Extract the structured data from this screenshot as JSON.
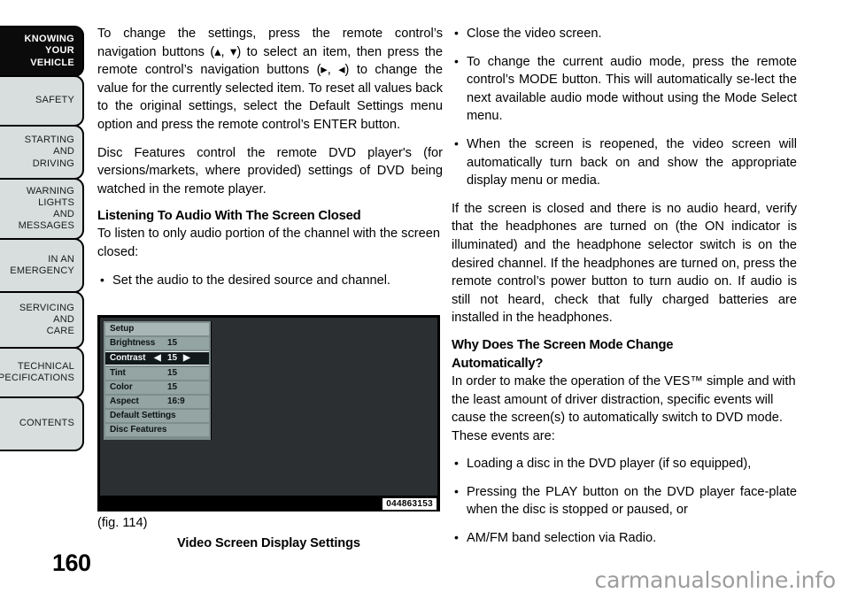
{
  "sidebar": {
    "items": [
      {
        "label": "KNOWING\nYOUR\nVEHICLE",
        "lines": [
          "KNOWING",
          "YOUR",
          "VEHICLE"
        ],
        "active": true
      },
      {
        "label": "SAFETY",
        "lines": [
          "SAFETY"
        ],
        "active": false
      },
      {
        "label": "STARTING AND DRIVING",
        "lines": [
          "STARTING",
          "AND",
          "DRIVING"
        ],
        "active": false
      },
      {
        "label": "WARNING LIGHTS AND MESSAGES",
        "lines": [
          "WARNING",
          "LIGHTS",
          "AND",
          "MESSAGES"
        ],
        "active": false
      },
      {
        "label": "IN AN EMERGENCY",
        "lines": [
          "IN AN",
          "EMERGENCY"
        ],
        "active": false
      },
      {
        "label": "SERVICING AND CARE",
        "lines": [
          "SERVICING",
          "AND",
          "CARE"
        ],
        "active": false
      },
      {
        "label": "TECHNICAL SPECIFICATIONS",
        "lines": [
          "TECHNICAL",
          "SPECIFICATIONS"
        ],
        "active": false
      },
      {
        "label": "CONTENTS",
        "lines": [
          "CONTENTS"
        ],
        "active": false
      }
    ]
  },
  "page": {
    "number": "160",
    "watermark": "carmanualsonline.info"
  },
  "left_column": {
    "para1": "To change the settings, press the remote control’s navigation buttons (▴, ▾) to select an item, then press the remote control’s navigation buttons (▸, ◂) to change the value for the currently selected item. To reset all values back to the original settings, select the Default Settings menu option and press the remote control’s ENTER button.",
    "para2": "Disc Features control the remote DVD player's (for versions/markets, where provided) settings of DVD being watched in the remote player.",
    "subheading": "Listening To Audio With The Screen Closed",
    "para3": "To listen to only audio portion of the channel with the screen closed:",
    "bullets": [
      "Set the audio to the desired source and channel."
    ]
  },
  "right_column": {
    "bullets_top": [
      "Close the video screen.",
      "To change the current audio mode, press the remote control’s MODE button. This will automatically se-lect the next available audio mode without using the Mode Select menu.",
      "When the screen is reopened, the video screen will automatically turn back on and show the appropriate display menu or media."
    ],
    "para1": "If the screen is closed and there is no audio heard, verify that the headphones are turned on (the ON indicator is illuminated) and the headphone selector switch is on the desired channel. If the headphones are turned on, press the remote control’s power button to turn audio on. If audio is still not heard, check that fully charged batteries are installed in the headphones.",
    "subheading_line1": "Why Does The Screen Mode Change",
    "subheading_line2": "Automatically?",
    "para2": "In order to make the operation of the VES™ simple and with the least amount of driver distraction, specific events will cause the screen(s) to automatically switch to DVD mode. These events are:",
    "bullets_bottom": [
      "Loading a disc in the DVD player (if so equipped),",
      "Pressing the PLAY button on the DVD player face-plate when the disc is stopped or paused, or",
      "AM/FM band selection via Radio."
    ]
  },
  "figure": {
    "label": "(fig. 114)",
    "caption": "Video Screen Display Settings",
    "code": "044863153",
    "osd": {
      "title": "Setup",
      "rows": [
        {
          "name": "Brightness",
          "value": "15",
          "selected": false
        },
        {
          "name": "Contrast",
          "value": "15",
          "selected": true,
          "arrow_left": "◀",
          "arrow_right": "▶"
        },
        {
          "name": "Tint",
          "value": "15",
          "selected": false
        },
        {
          "name": "Color",
          "value": "15",
          "selected": false
        },
        {
          "name": "Aspect",
          "value": "16:9",
          "selected": false
        },
        {
          "name": "Default Settings",
          "value": "",
          "selected": false
        },
        {
          "name": "Disc Features",
          "value": "",
          "selected": false
        }
      ]
    }
  },
  "colors": {
    "tab_background": "#d7dedd",
    "tab_active_background": "#0b0b0b",
    "osd_panel": "#7d8d8c",
    "osd_row": "#94a4a3",
    "osd_selected": "#12191b",
    "screen_background": "#2b2f31",
    "watermark": "#9d9d9d"
  }
}
